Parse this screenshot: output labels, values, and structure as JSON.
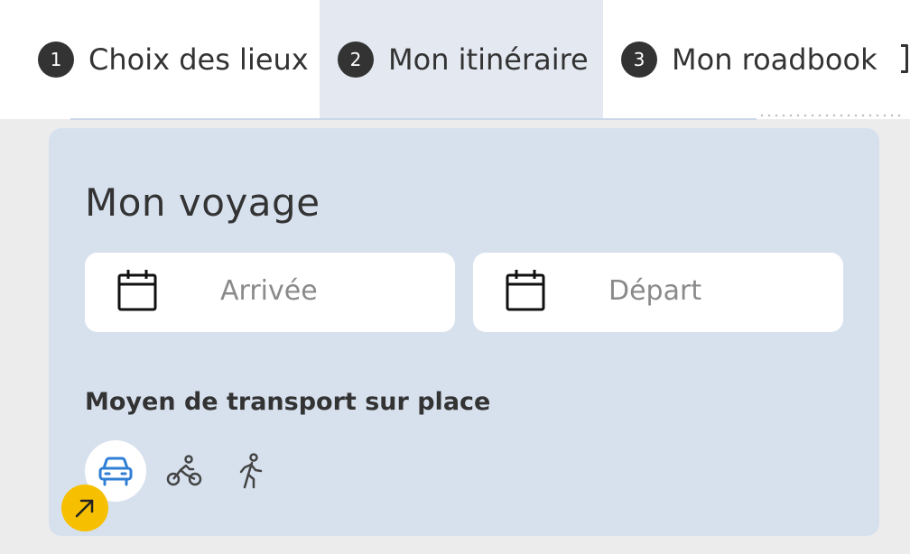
{
  "steps": [
    {
      "number": "1",
      "label": "Choix des lieux",
      "active": false
    },
    {
      "number": "2",
      "label": "Mon itinéraire",
      "active": true
    },
    {
      "number": "3",
      "label": "Mon roadbook",
      "active": false
    }
  ],
  "trip": {
    "title": "Mon voyage",
    "arrival_placeholder": "Arrivée",
    "departure_placeholder": "Départ",
    "calendar_icon": "calendar-icon"
  },
  "transport": {
    "label": "Moyen de transport sur place",
    "options": [
      {
        "id": "car",
        "icon": "car-icon",
        "selected": true
      },
      {
        "id": "bike",
        "icon": "bicycle-icon",
        "selected": false
      },
      {
        "id": "walk",
        "icon": "walking-icon",
        "selected": false
      }
    ]
  },
  "colors": {
    "accent": "#2f7fd6",
    "active_tab": "#e3e8f1",
    "card": "#d7e1ee",
    "cursor_badge": "#f6c000"
  }
}
